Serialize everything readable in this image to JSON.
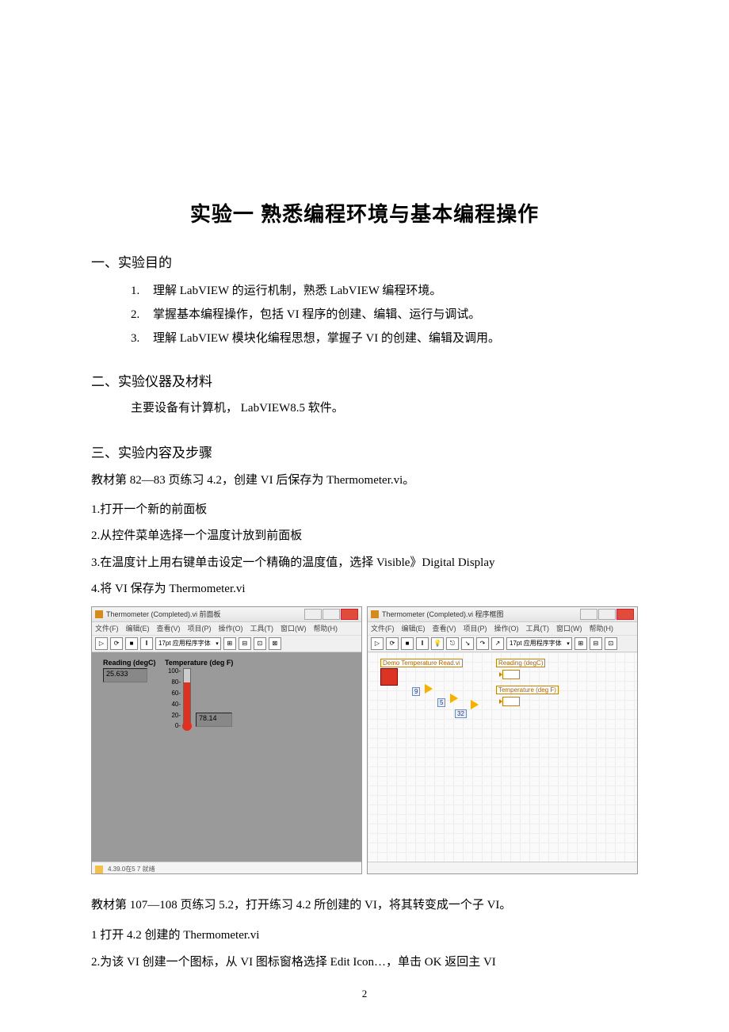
{
  "title": "实验一   熟悉编程环境与基本编程操作",
  "sections": {
    "s1": {
      "heading": "一、实验目的",
      "items": [
        {
          "n": "1.",
          "t": "理解 LabVIEW 的运行机制，熟悉 LabVIEW 编程环境。"
        },
        {
          "n": "2.",
          "t": "掌握基本编程操作，包括 VI 程序的创建、编辑、运行与调试。"
        },
        {
          "n": "3.",
          "t": "理解 LabVIEW 模块化编程思想，掌握子 VI 的创建、编辑及调用。"
        }
      ]
    },
    "s2": {
      "heading": "二、实验仪器及材料",
      "equip": "主要设备有计算机， LabVIEW8.5 软件。"
    },
    "s3": {
      "heading": "三、实验内容及步骤",
      "intro": "教材第 82—83 页练习 4.2，创建 VI 后保存为 Thermometer.vi。",
      "steps": [
        "1.打开一个新的前面板",
        "2.从控件菜单选择一个温度计放到前面板",
        "3.在温度计上用右键单击设定一个精确的温度值，选择 Visible》Digital Display",
        "4.将 VI 保存为 Thermometer.vi"
      ],
      "followup_intro": "教材第 107—108 页练习 5.2，打开练习 4.2 所创建的 VI，将其转变成一个子 VI。",
      "followup_steps": [
        "1 打开 4.2 创建的 Thermometer.vi",
        "2.为该 VI 创建一个图标，从 VI 图标窗格选择 Edit Icon…，单击 OK 返回主 VI"
      ]
    }
  },
  "screenshots": {
    "fp": {
      "title": "Thermometer (Completed).vi 前面板",
      "menus": [
        "文件(F)",
        "编辑(E)",
        "查看(V)",
        "项目(P)",
        "操作(O)",
        "工具(T)",
        "窗口(W)",
        "帮助(H)"
      ],
      "font": "17pt 应用程序字体",
      "reading": {
        "label": "Reading (degC)",
        "value": "25.633"
      },
      "thermo": {
        "label": "Temperature (deg F)",
        "digital": "78.14",
        "ticks": [
          "100-",
          "80-",
          "60-",
          "40-",
          "20-",
          "0-"
        ]
      },
      "status": "4.39.0在5      7      就绪"
    },
    "bd": {
      "title": "Thermometer (Completed).vi 程序框图",
      "menus": [
        "文件(F)",
        "编辑(E)",
        "查看(V)",
        "项目(P)",
        "操作(O)",
        "工具(T)",
        "窗口(W)",
        "帮助(H)"
      ],
      "font": "17pt 应用程序字体",
      "nodes": {
        "demo": "Demo Temperature Read.vi",
        "reading": "Reading (degC)",
        "temp": "Temperature (deg F)",
        "c1": "9",
        "c2": "5",
        "c3": "32"
      }
    }
  },
  "page_number": "2"
}
